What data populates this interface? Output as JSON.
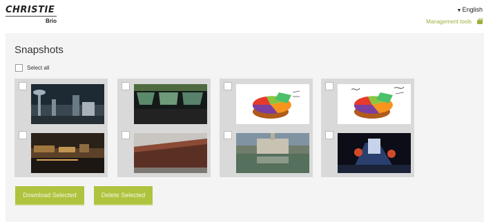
{
  "header": {
    "logo_text": "CHRISTIE",
    "logo_sub": "Brio",
    "language": "English",
    "management_tools": "Management tools"
  },
  "main": {
    "title": "Snapshots",
    "select_all_label": "Select all",
    "download_label": "Download Selected",
    "delete_label": "Delete Selected"
  },
  "snapshots": [
    {
      "scene": "city-night-towers"
    },
    {
      "scene": "cockpit-view"
    },
    {
      "scene": "pie-chart"
    },
    {
      "scene": "pie-chart-annotated"
    },
    {
      "scene": "waterfront-night"
    },
    {
      "scene": "ship-hull"
    },
    {
      "scene": "palace-reflection"
    },
    {
      "scene": "concert-stage"
    }
  ],
  "colors": {
    "accent": "#afc33f",
    "link": "#9ab03a",
    "panel_bg": "#f4f4f4",
    "group_bg": "#d9d9d9"
  }
}
